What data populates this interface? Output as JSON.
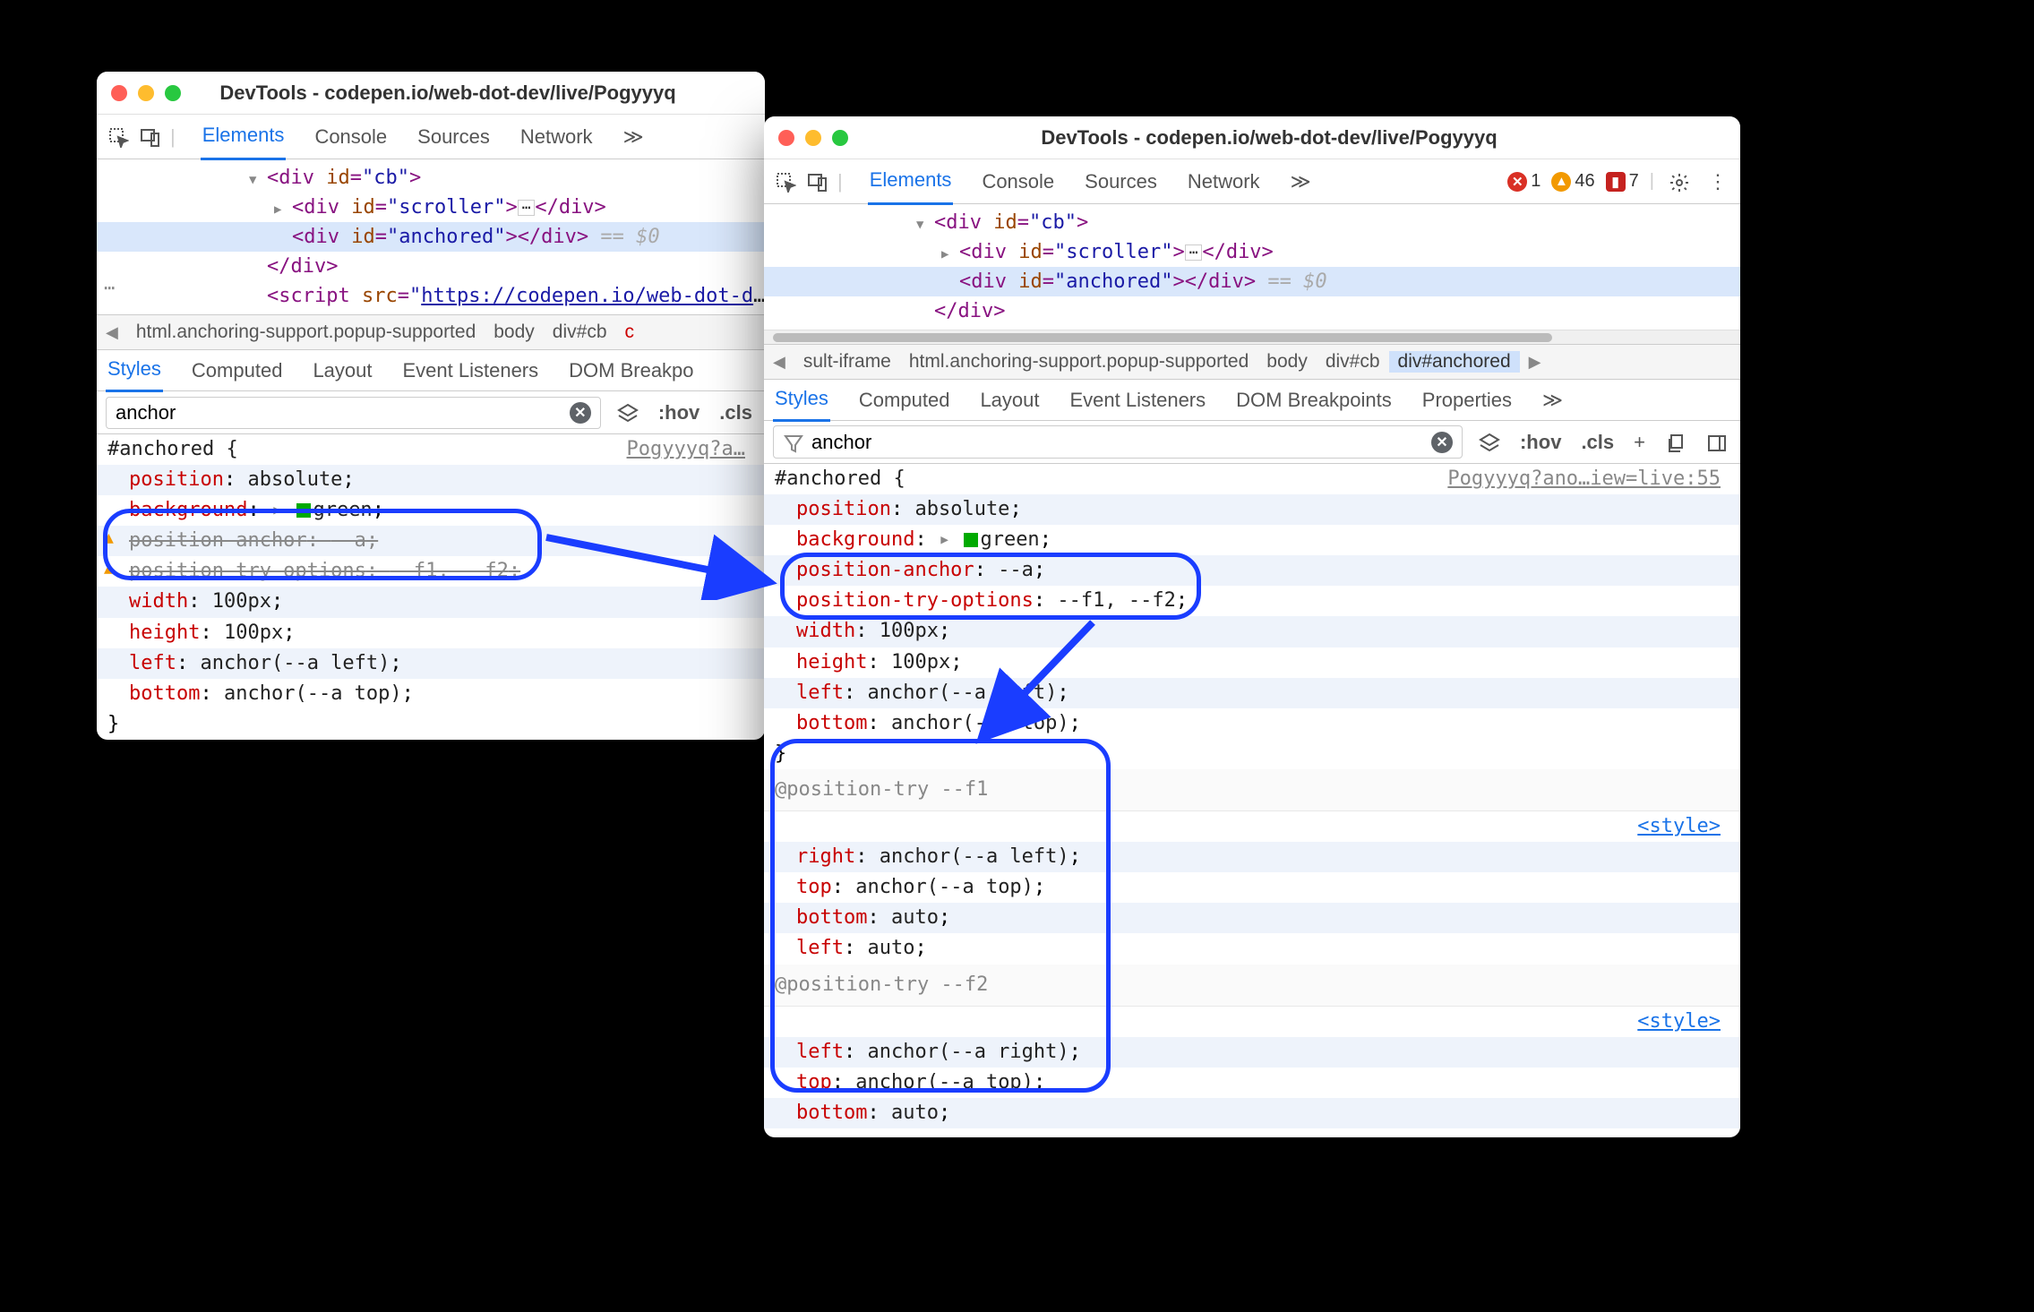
{
  "window_title": "DevTools - codepen.io/web-dot-dev/live/Pogyyyq",
  "main_tabs": [
    "Elements",
    "Console",
    "Sources",
    "Network"
  ],
  "more_glyph": "≫",
  "badges": {
    "errors": "1",
    "warnings": "46",
    "violations": "7"
  },
  "elements_tree": {
    "l1": {
      "pre": "<div ",
      "attr": "id",
      "val": "\"cb\"",
      "post": ">"
    },
    "l2": {
      "pre": "<div ",
      "attr": "id",
      "val": "\"scroller\"",
      "post": ">",
      "close": "</div>"
    },
    "l3": {
      "pre": "<div ",
      "attr": "id",
      "val": "\"anchored\"",
      "post": ">",
      "closefull": "</div>",
      "eq": "== $0"
    },
    "l4": "</div>",
    "l5": {
      "pre": "<script ",
      "attr": "src",
      "val": "\"https://codepen.io/web-dot-d",
      "dots": "…"
    }
  },
  "breadcrumb_left": [
    "html.anchoring-support.popup-supported",
    "body",
    "div#cb"
  ],
  "breadcrumb_right_pre": "sult-iframe",
  "breadcrumb_right": [
    "html.anchoring-support.popup-supported",
    "body",
    "div#cb",
    "div#anchored"
  ],
  "subtabs_left": [
    "Styles",
    "Computed",
    "Layout",
    "Event Listeners",
    "DOM Breakpo"
  ],
  "subtabs_right": [
    "Styles",
    "Computed",
    "Layout",
    "Event Listeners",
    "DOM Breakpoints",
    "Properties"
  ],
  "filter_value": "anchor",
  "filter_btns": {
    "hov": ":hov",
    "cls": ".cls"
  },
  "style_source_left": "Pogyyyq?a…",
  "style_source_right": "Pogyyyq?ano…iew=live:55",
  "style_link": "<style>",
  "css_left": {
    "selector": "#anchored {",
    "p1": "position",
    "v1": "absolute",
    "p2": "background",
    "v2": "green",
    "p3": "position-anchor",
    "v3": "--a",
    "p4": "position-try-options",
    "v4": "--f1, --f2",
    "p5": "width",
    "v5": "100px",
    "p6": "height",
    "v6": "100px",
    "p7": "left",
    "v7": "anchor(--a left)",
    "p8": "bottom",
    "v8": "anchor(--a top)",
    "close": "}"
  },
  "css_right": {
    "selector": "#anchored {",
    "p1": "position",
    "v1": "absolute",
    "p2": "background",
    "v2": "green",
    "p3": "position-anchor",
    "v3": "--a",
    "p4": "position-try-options",
    "v4": "--f1, --f2",
    "p5": "width",
    "v5": "100px",
    "p6": "height",
    "v6": "100px",
    "p7": "left",
    "v7": "anchor(--a left)",
    "p8": "bottom",
    "v8": "anchor(--a top)",
    "close": "}"
  },
  "pt1": {
    "header": "@position-try --f1",
    "p1": "right",
    "v1": "anchor(--a left)",
    "p2": "top",
    "v2": "anchor(--a top)",
    "p3": "bottom",
    "v3": "auto",
    "p4": "left",
    "v4": "auto"
  },
  "pt2": {
    "header": "@position-try --f2",
    "p1": "left",
    "v1": "anchor(--a right)",
    "p2": "top",
    "v2": "anchor(--a top)",
    "p3": "bottom",
    "v3": "auto"
  }
}
